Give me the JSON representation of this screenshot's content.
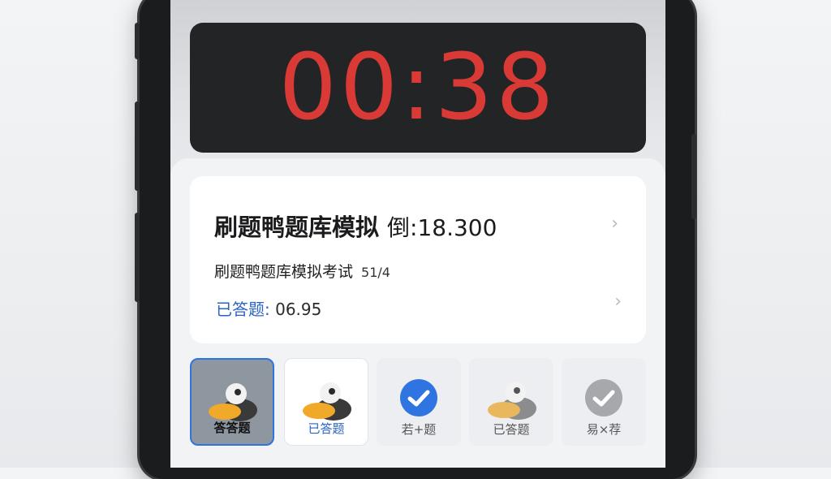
{
  "timer": {
    "display": "00:38"
  },
  "card": {
    "title": "刷题鸭题库模拟",
    "title_extra": "倒:18.300",
    "subtitle": "刷题鸭题库模拟考试",
    "subtitle_count": "51/4",
    "answered_label": "已答题:",
    "answered_value": " 06.95"
  },
  "tiles": [
    {
      "label": "答答题",
      "icon": "duck-icon",
      "state": "selected"
    },
    {
      "label": "已答题",
      "icon": "duck-icon",
      "state": "white"
    },
    {
      "label": "若+题",
      "icon": "check-circle-blue-icon",
      "state": "normal"
    },
    {
      "label": "已答题",
      "icon": "duck-icon",
      "state": "normal"
    },
    {
      "label": "易×荐",
      "icon": "check-circle-gray-icon",
      "state": "normal"
    }
  ],
  "colors": {
    "timer_digits": "#d93a35",
    "accent_blue": "#2f74e0",
    "label_blue": "#2a63c6"
  }
}
